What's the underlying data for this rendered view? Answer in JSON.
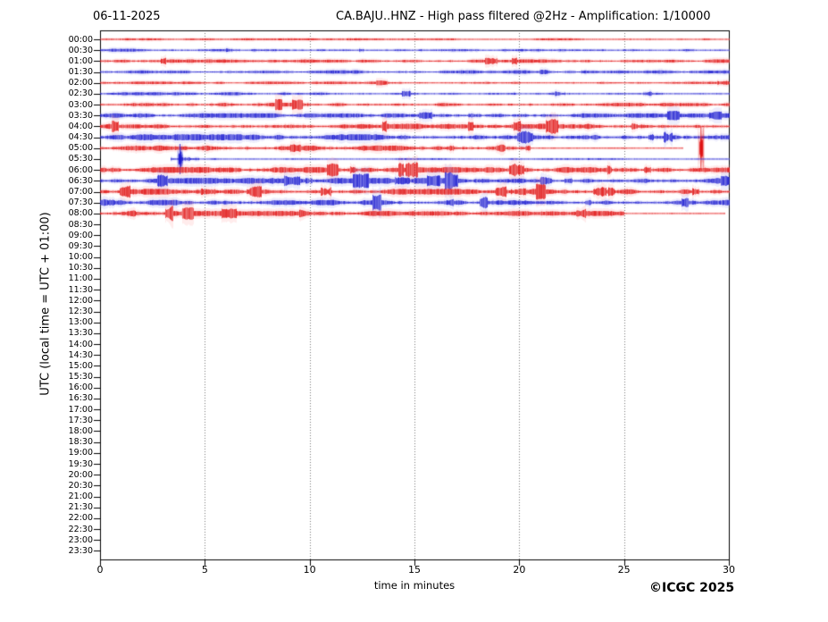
{
  "header": {
    "date": "06-11-2025",
    "title": "CA.BAJU..HNZ - High pass filtered @2Hz - Amplification: 1/10000"
  },
  "footer": {
    "copyright": "©ICGC 2025"
  },
  "chart_data": {
    "type": "line",
    "subtype": "helicorder-daily-seismogram",
    "title": "CA.BAJU..HNZ - High pass filtered @2Hz - Amplification: 1/10000",
    "date": "06-11-2025",
    "xlabel": "time in minutes",
    "ylabel": "UTC (local time = UTC + 01:00)",
    "xlim": [
      0,
      30
    ],
    "x_ticks": [
      0,
      5,
      10,
      15,
      20,
      25,
      30
    ],
    "grid_minutes": [
      5,
      10,
      15,
      20,
      25
    ],
    "grid_on": true,
    "legend": "none",
    "row_labels": [
      "00:00",
      "00:30",
      "01:00",
      "01:30",
      "02:00",
      "02:30",
      "03:00",
      "03:30",
      "04:00",
      "04:30",
      "05:00",
      "05:30",
      "06:00",
      "06:30",
      "07:00",
      "07:30",
      "08:00",
      "08:30",
      "09:00",
      "09:30",
      "10:00",
      "10:30",
      "11:00",
      "11:30",
      "12:00",
      "12:30",
      "13:00",
      "13:30",
      "14:00",
      "14:30",
      "15:00",
      "15:30",
      "16:00",
      "16:30",
      "17:00",
      "17:30",
      "18:00",
      "18:30",
      "19:00",
      "19:30",
      "20:00",
      "20:30",
      "21:00",
      "21:30",
      "22:00",
      "22:30",
      "23:00",
      "23:30"
    ],
    "colors": {
      "red": "#e01212",
      "red_halo": "#ff8080",
      "blue": "#1b1bd0",
      "blue_halo": "#8888ee",
      "grid": "#777777",
      "frame": "#000000",
      "background": "#ffffff"
    },
    "traces": [
      {
        "label": "00:00",
        "row": 0,
        "color": "red",
        "segments": [
          {
            "from": 0,
            "to": 30,
            "amp": 0.55,
            "burst": 0.05
          }
        ]
      },
      {
        "label": "00:30",
        "row": 1,
        "color": "blue",
        "segments": [
          {
            "from": 0,
            "to": 30,
            "amp": 0.8,
            "burst": 0.1
          }
        ]
      },
      {
        "label": "01:00",
        "row": 2,
        "color": "red",
        "segments": [
          {
            "from": 0,
            "to": 30,
            "amp": 0.95,
            "burst": 0.15
          }
        ]
      },
      {
        "label": "01:30",
        "row": 3,
        "color": "blue",
        "segments": [
          {
            "from": 0,
            "to": 30,
            "amp": 0.95,
            "burst": 0.12
          }
        ]
      },
      {
        "label": "02:00",
        "row": 4,
        "color": "red",
        "segments": [
          {
            "from": 0,
            "to": 30,
            "amp": 0.7,
            "burst": 0.08
          }
        ]
      },
      {
        "label": "02:30",
        "row": 5,
        "color": "blue",
        "segments": [
          {
            "from": 0,
            "to": 30,
            "amp": 0.85,
            "burst": 0.1
          }
        ]
      },
      {
        "label": "03:00",
        "row": 6,
        "color": "red",
        "segments": [
          {
            "from": 0,
            "to": 30,
            "amp": 1.05,
            "burst": 0.2
          }
        ]
      },
      {
        "label": "03:30",
        "row": 7,
        "color": "blue",
        "segments": [
          {
            "from": 0,
            "to": 30,
            "amp": 1.25,
            "burst": 0.3
          }
        ]
      },
      {
        "label": "04:00",
        "row": 8,
        "color": "red",
        "segments": [
          {
            "from": 0,
            "to": 30,
            "amp": 1.5,
            "burst": 0.5
          }
        ]
      },
      {
        "label": "04:30",
        "row": 9,
        "color": "blue",
        "segments": [
          {
            "from": 0,
            "to": 30,
            "amp": 1.7,
            "burst": 0.6
          }
        ]
      },
      {
        "label": "05:00",
        "row": 10,
        "color": "red",
        "segments": [
          {
            "from": 0,
            "to": 20.5,
            "amp": 1.5,
            "burst": 0.5
          },
          {
            "from": 20.5,
            "to": 27.8,
            "amp": 0.3,
            "burst": 0
          }
        ],
        "events": [
          {
            "minute": 28.65,
            "half_light": 24,
            "half_dense": 12
          }
        ]
      },
      {
        "label": "05:30",
        "row": 11,
        "color": "blue",
        "segments": [
          {
            "from": 3.35,
            "to": 3.72,
            "amp": 1.2,
            "burst": 0.2
          },
          {
            "from": 3.72,
            "to": 4.3,
            "amp": 2.4,
            "burst": 0.4
          },
          {
            "from": 4.3,
            "to": 4.7,
            "amp": 1.1,
            "burst": 0.1
          },
          {
            "from": 4.7,
            "to": 30,
            "amp": 0.45,
            "burst": 0.12
          }
        ],
        "events": [
          {
            "minute": 3.8,
            "half_light": 17,
            "half_dense": 10
          }
        ]
      },
      {
        "label": "06:00",
        "row": 12,
        "color": "red",
        "segments": [
          {
            "from": 0,
            "to": 30,
            "amp": 1.6,
            "burst": 0.55
          }
        ]
      },
      {
        "label": "06:30",
        "row": 13,
        "color": "blue",
        "segments": [
          {
            "from": 0,
            "to": 30,
            "amp": 1.6,
            "burst": 0.55
          }
        ]
      },
      {
        "label": "07:00",
        "row": 14,
        "color": "red",
        "segments": [
          {
            "from": 0,
            "to": 30,
            "amp": 1.6,
            "burst": 0.5
          }
        ]
      },
      {
        "label": "07:30",
        "row": 15,
        "color": "blue",
        "segments": [
          {
            "from": 0,
            "to": 1.2,
            "amp": 2.2,
            "burst": 0.8
          },
          {
            "from": 1.2,
            "to": 30,
            "amp": 1.5,
            "burst": 0.5
          }
        ]
      },
      {
        "label": "08:00",
        "row": 16,
        "color": "red",
        "segments": [
          {
            "from": 0,
            "to": 25,
            "amp": 1.4,
            "burst": 0.45
          },
          {
            "from": 25,
            "to": 29.8,
            "amp": 0.3,
            "burst": 0
          }
        ]
      }
    ]
  }
}
